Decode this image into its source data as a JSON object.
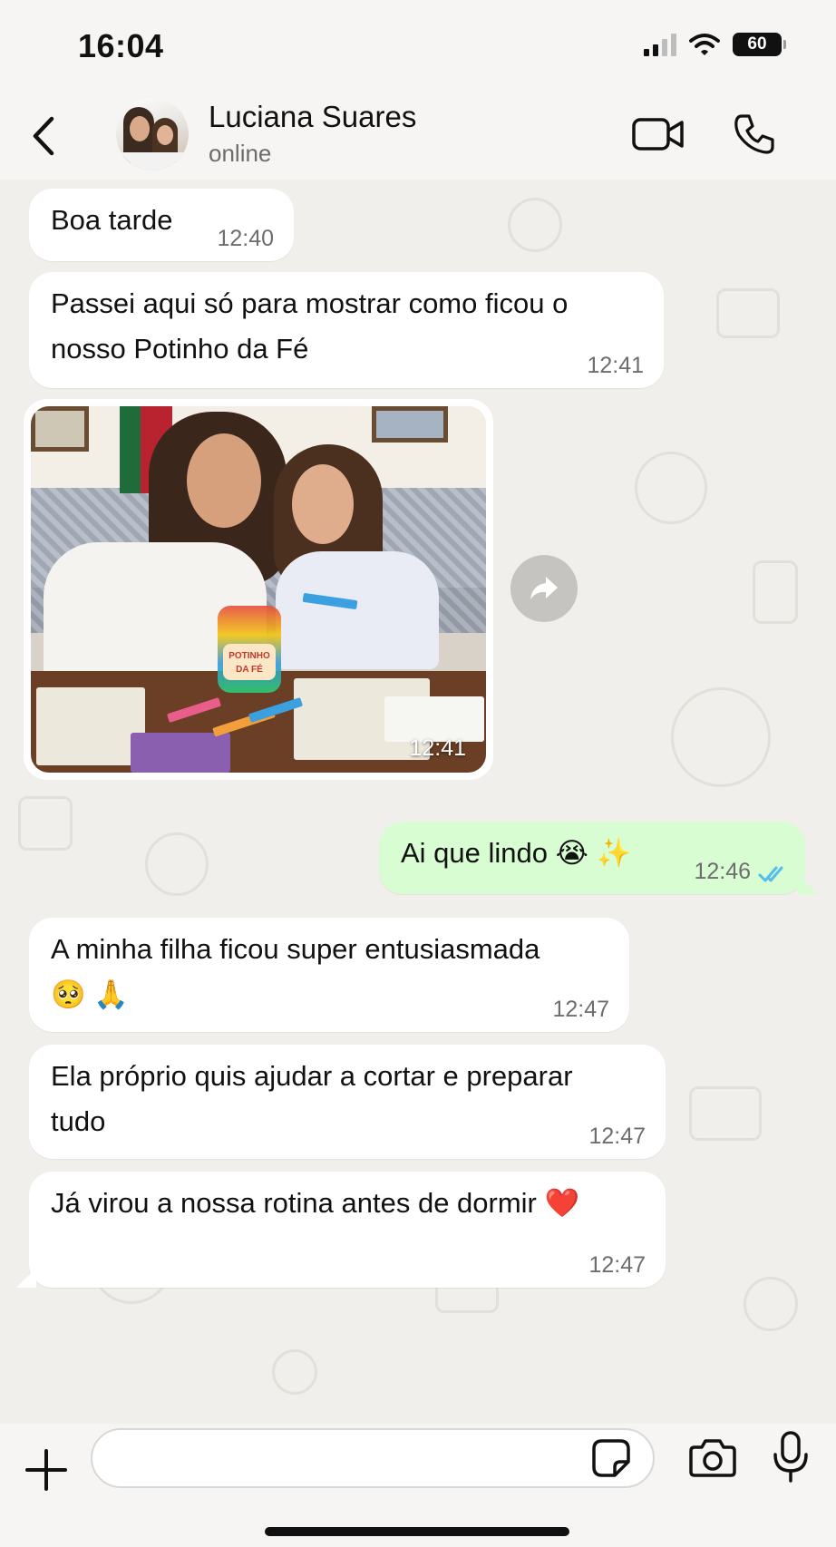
{
  "status_bar": {
    "time": "16:04",
    "battery": "60",
    "icons": [
      "signal-icon",
      "wifi-icon",
      "battery-icon"
    ]
  },
  "header": {
    "contact_name": "Luciana Suares",
    "contact_status": "online",
    "icons": [
      "back-icon",
      "video-call-icon",
      "phone-icon"
    ]
  },
  "messages": [
    {
      "direction": "in",
      "type": "text",
      "lines": [
        "Boa tarde"
      ],
      "time": "12:40"
    },
    {
      "direction": "in",
      "type": "text",
      "lines": [
        "Passei aqui só para mostrar como ficou o",
        "nosso Potinho da Fé"
      ],
      "time": "12:41"
    },
    {
      "direction": "in",
      "type": "image",
      "time": "12:41",
      "caption_on_image": [
        "POTINHO",
        "DA FÉ"
      ]
    },
    {
      "direction": "out",
      "type": "text",
      "lines": [
        "Ai que lindo 😭 ✨"
      ],
      "time": "12:46",
      "read": true
    },
    {
      "direction": "in",
      "type": "text",
      "lines": [
        "A minha filha ficou super entusiasmada",
        "🥺 🙏"
      ],
      "time": "12:47"
    },
    {
      "direction": "in",
      "type": "text",
      "lines": [
        "Ela próprio quis ajudar a cortar e preparar",
        "tudo"
      ],
      "time": "12:47"
    },
    {
      "direction": "in",
      "type": "text",
      "lines": [
        "Já virou a nossa rotina antes de dormir ❤️"
      ],
      "time": "12:47"
    }
  ],
  "composer": {
    "value": "",
    "placeholder": "",
    "icons": [
      "plus-icon",
      "sticker-icon",
      "camera-icon",
      "mic-icon"
    ]
  },
  "colors": {
    "incoming_bubble": "#ffffff",
    "outgoing_bubble": "#d9fdd3",
    "read_ticks": "#53bdeb",
    "chat_background": "#f1efeb"
  }
}
